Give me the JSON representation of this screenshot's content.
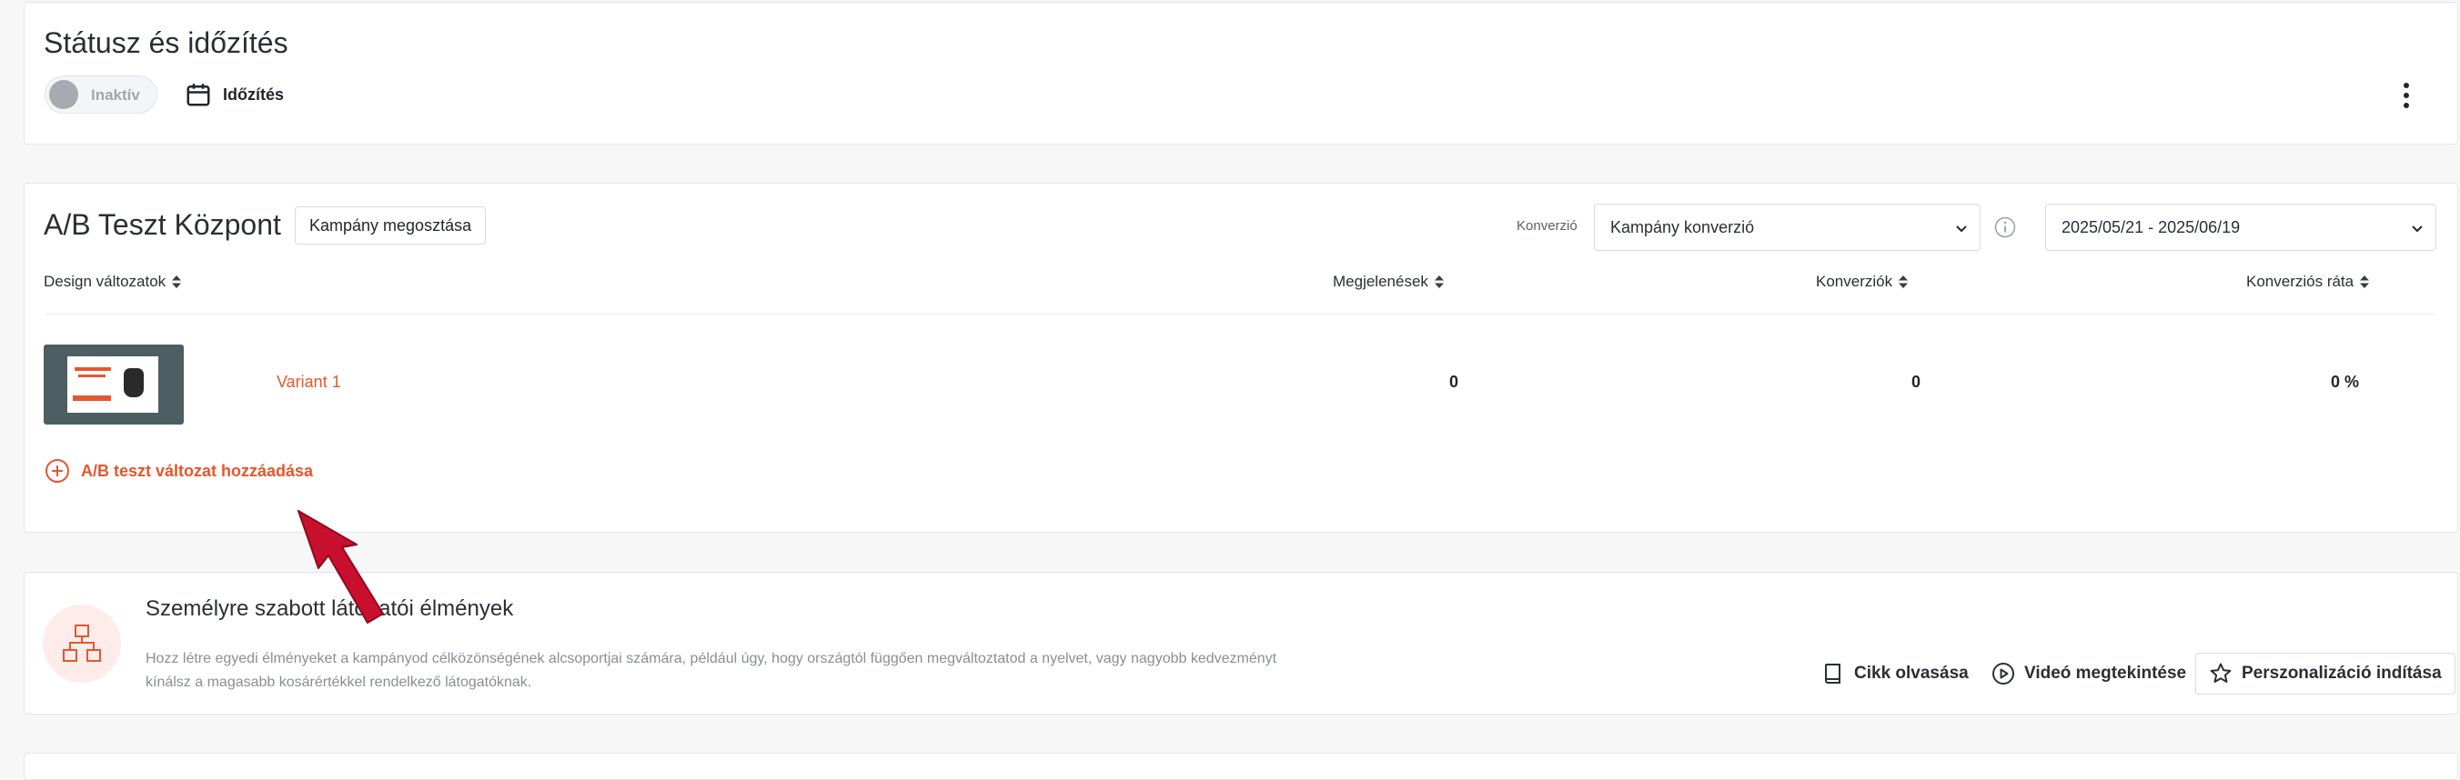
{
  "status": {
    "title": "Státusz és időzítés",
    "toggle_label": "Inaktív",
    "timing_label": "Időzítés",
    "icons": {
      "timing": "calendar-icon",
      "more": "kebab-menu-icon"
    }
  },
  "ab": {
    "title": "A/B Teszt Központ",
    "share_label": "Kampány megosztása",
    "conversion_label": "Konverzió",
    "conversion_value": "Kampány konverzió",
    "date_range": "2025/05/21 - 2025/06/19",
    "columns": {
      "design": "Design változatok",
      "impressions": "Megjelenések",
      "conversions": "Konverziók",
      "rate": "Konverziós ráta"
    },
    "variants": [
      {
        "name": "Variant 1",
        "impressions": "0",
        "conversions": "0",
        "rate": "0 %"
      }
    ],
    "add_label": "A/B teszt változat hozzáadása"
  },
  "personalization": {
    "title": "Személyre szabott látogatói élmények",
    "desc_line1": "Hozz létre egyedi élményeket a kampányod célközönségének alcsoportjai számára, például úgy, hogy országtól függően megváltoztatod a nyelvet, vagy nagyobb kedvezményt",
    "desc_line2": "kínálsz a magasabb kosárértékkel rendelkező látogatóknak.",
    "read_label": "Cikk olvasása",
    "video_label": "Videó megtekintése",
    "start_label": "Perszonalizáció indítása"
  },
  "colors": {
    "accent": "#e4572e",
    "arrow": "#c8102e",
    "text": "#23262a",
    "muted": "#8a8e94"
  }
}
